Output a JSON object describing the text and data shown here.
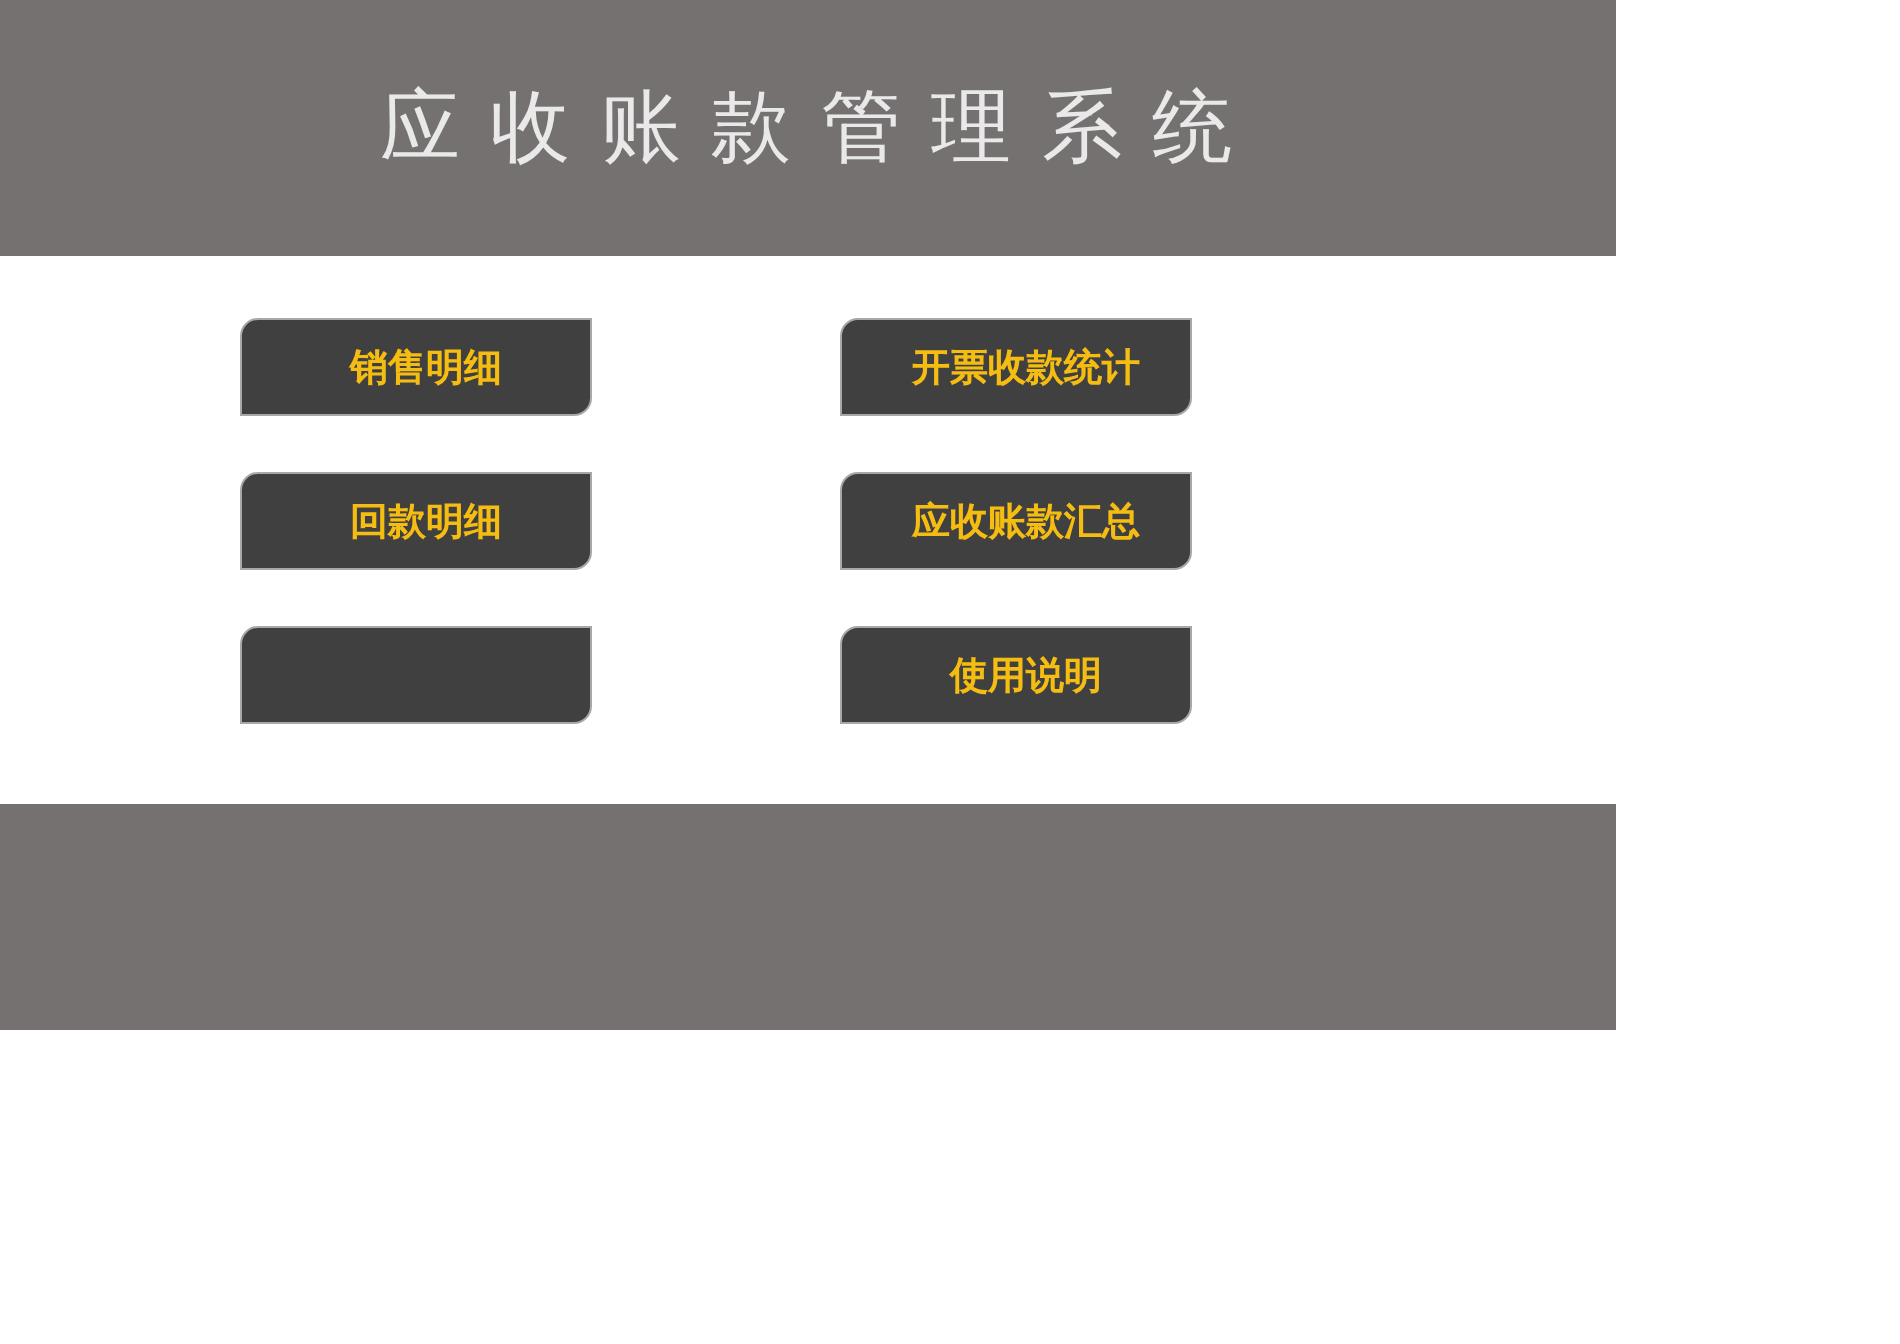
{
  "header": {
    "title": "应 收 账 款 管 理 系 统"
  },
  "buttons": [
    {
      "kind": "labeled",
      "label": "销售明细"
    },
    {
      "kind": "labeled",
      "label": "开票收款统计"
    },
    {
      "kind": "labeled",
      "label": "回款明细"
    },
    {
      "kind": "labeled",
      "label": "应收账款汇总"
    },
    {
      "kind": "blank"
    },
    {
      "kind": "labeled",
      "label": "使用说明"
    }
  ]
}
